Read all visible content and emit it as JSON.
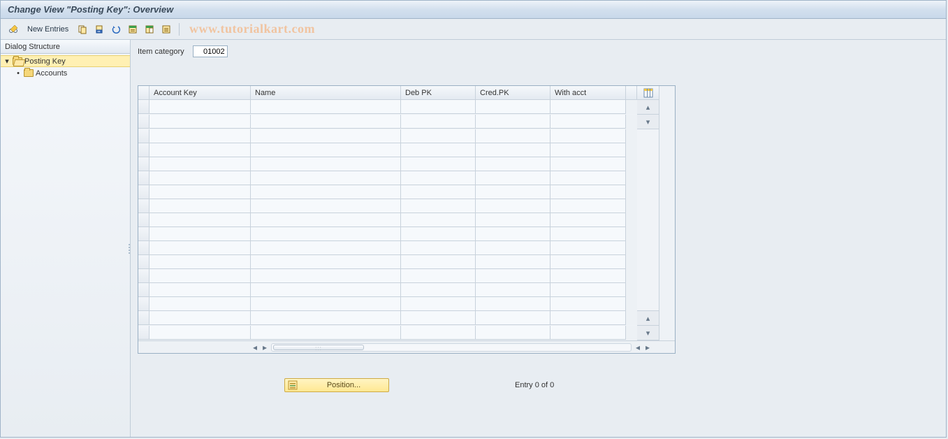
{
  "title": "Change View \"Posting Key\": Overview",
  "toolbar": {
    "new_entries_label": "New Entries"
  },
  "watermark": "www.tutorialkart.com",
  "sidebar": {
    "header": "Dialog Structure",
    "items": [
      {
        "label": "Posting Key"
      },
      {
        "label": "Accounts"
      }
    ]
  },
  "form": {
    "item_category_label": "Item category",
    "item_category_value": "01002"
  },
  "table": {
    "columns": [
      "Account Key",
      "Name",
      "Deb PK",
      "Cred.PK",
      "With acct"
    ],
    "row_count": 17,
    "rows": []
  },
  "footer": {
    "position_label": "Position...",
    "entry_status": "Entry 0 of 0"
  }
}
